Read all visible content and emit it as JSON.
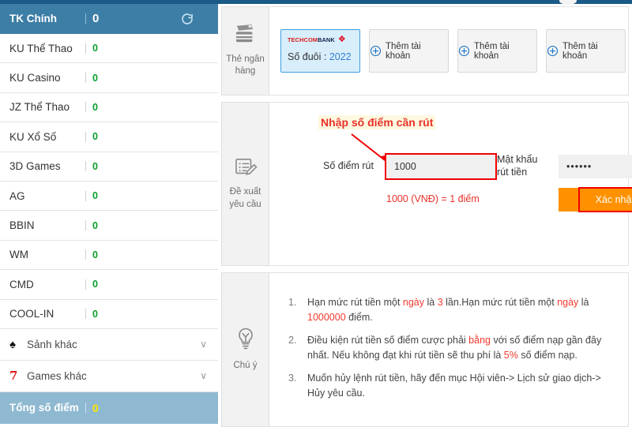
{
  "sidebar": {
    "header": {
      "name": "TK Chính",
      "value": "0",
      "refresh_icon": "refresh-icon"
    },
    "accounts": [
      {
        "name": "KU Thể Thao",
        "value": "0"
      },
      {
        "name": "KU Casino",
        "value": "0"
      },
      {
        "name": "JZ Thể Thao",
        "value": "0"
      },
      {
        "name": "KU Xổ Số",
        "value": "0"
      },
      {
        "name": "3D Games",
        "value": "0"
      },
      {
        "name": "AG",
        "value": "0"
      },
      {
        "name": "BBIN",
        "value": "0"
      },
      {
        "name": "WM",
        "value": "0"
      },
      {
        "name": "CMD",
        "value": "0"
      },
      {
        "name": "COOL-IN",
        "value": "0"
      }
    ],
    "groups": [
      {
        "label": "Sảnh khác",
        "icon": "spade-icon",
        "glyph": "♠",
        "chevron": "∨"
      },
      {
        "label": "Games khác",
        "icon": "seven-icon",
        "glyph": "7",
        "chevron": "∨"
      }
    ],
    "total": {
      "label": "Tổng số điểm",
      "value": "0"
    }
  },
  "bank_panel": {
    "side_label": "Thẻ ngân hàng",
    "side_icon": "credit-card-icon",
    "card": {
      "brand_red": "TECHCOM",
      "brand_black": "BANK",
      "brand_mark": "❖",
      "tail_label": "Số đuôi :",
      "tail_value": "2022"
    },
    "add_buttons": [
      {
        "label": "Thêm tài khoản",
        "icon": "plus-circle-icon"
      },
      {
        "label": "Thêm tài khoản",
        "icon": "plus-circle-icon"
      },
      {
        "label": "Thêm tài khoản",
        "icon": "plus-circle-icon"
      }
    ]
  },
  "request_panel": {
    "side_label": "Đề xuất yêu cầu",
    "side_icon": "list-edit-icon",
    "annotation": "Nhập số điểm cần rút",
    "points_label": "Số điểm rút",
    "points_value": "1000",
    "points_placeholder": "",
    "password_label": "Mật khẩu rút tiền",
    "password_value": "••••••",
    "password_placeholder": "",
    "help_icon": "question-mark-icon",
    "rate_text": "1000 (VNĐ) = 1 điểm",
    "confirm_label": "Xác nhận"
  },
  "note_panel": {
    "side_label": "Chú ý",
    "side_icon": "lightbulb-icon",
    "notes": [
      {
        "parts": [
          {
            "t": "Hạn mức rút tiền một ",
            "hl": false
          },
          {
            "t": "ngày",
            "hl": true
          },
          {
            "t": " là ",
            "hl": false
          },
          {
            "t": "3",
            "hl": true
          },
          {
            "t": " lần.Hạn mức rút tiền một ",
            "hl": false
          },
          {
            "t": "ngày",
            "hl": true
          },
          {
            "t": " là ",
            "hl": false
          },
          {
            "t": "1000000",
            "hl": true
          },
          {
            "t": " điểm.",
            "hl": false
          }
        ]
      },
      {
        "parts": [
          {
            "t": "Điều kiện rút tiền số điểm cược phải ",
            "hl": false
          },
          {
            "t": "bằng",
            "hl": true
          },
          {
            "t": " với số điểm nạp gần đây nhất. Nếu không đạt khi rút tiền sẽ thu phí là ",
            "hl": false
          },
          {
            "t": "5%",
            "hl": true
          },
          {
            "t": " số điểm nạp.",
            "hl": false
          }
        ]
      },
      {
        "parts": [
          {
            "t": "Muốn hủy lệnh rút tiền, hãy đến mục Hội viên-> Lịch sử giao dịch-> Hủy yêu cầu.",
            "hl": false
          }
        ]
      }
    ]
  },
  "colors": {
    "sidebar_header": "#3d7ea6",
    "sidebar_total": "#8fb9d1",
    "accent_green": "#0a9e2e",
    "accent_yellow": "#ffe600",
    "confirm_orange": "#ff9100",
    "highlight_red": "#f23a2e",
    "annotation_bg": "#fdf8df",
    "card_blue": "#d9eefb",
    "topbar": "#1b5a87"
  }
}
